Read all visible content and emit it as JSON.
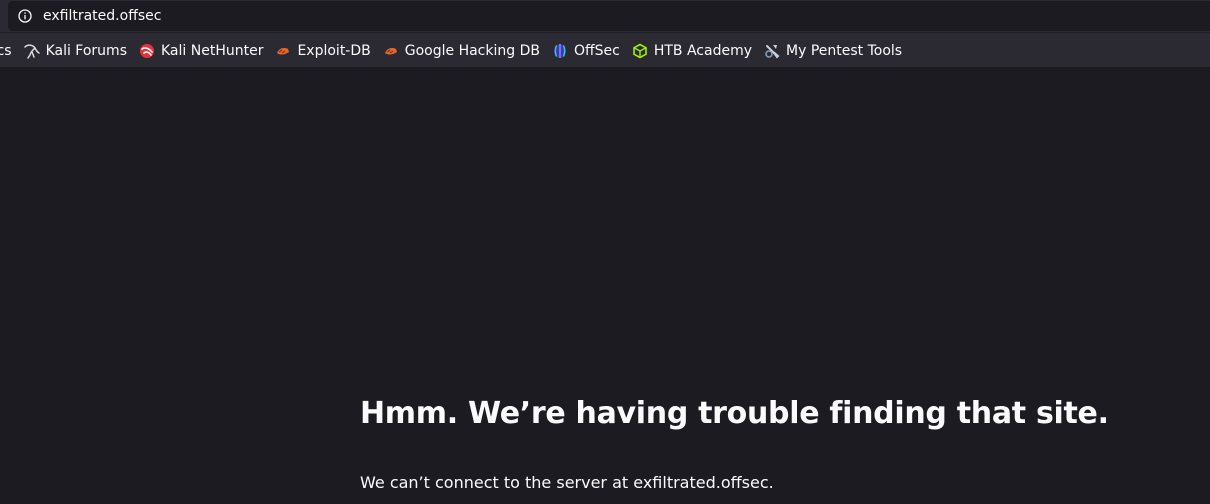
{
  "urlbar": {
    "url": "exfiltrated.offsec",
    "info_icon": "info-icon"
  },
  "bookmarks": [
    {
      "label": "ocs",
      "icon": "none"
    },
    {
      "label": "Kali Forums",
      "icon": "kali-dragon-icon",
      "color": "#dddddd"
    },
    {
      "label": "Kali NetHunter",
      "icon": "nethunter-icon",
      "color": "#e8313e"
    },
    {
      "label": "Exploit-DB",
      "icon": "exploit-db-icon",
      "color": "#e8662c"
    },
    {
      "label": "Google Hacking DB",
      "icon": "ghdb-icon",
      "color": "#e8662c"
    },
    {
      "label": "OffSec",
      "icon": "offsec-icon",
      "color": "#7b6cff"
    },
    {
      "label": "HTB Academy",
      "icon": "htb-icon",
      "color": "#9fef00"
    },
    {
      "label": "My Pentest Tools",
      "icon": "pentest-tools-icon",
      "color": "#c9d1dc"
    }
  ],
  "error": {
    "title": "Hmm. We’re having trouble finding that site.",
    "description": "We can’t connect to the server at exfiltrated.offsec."
  }
}
